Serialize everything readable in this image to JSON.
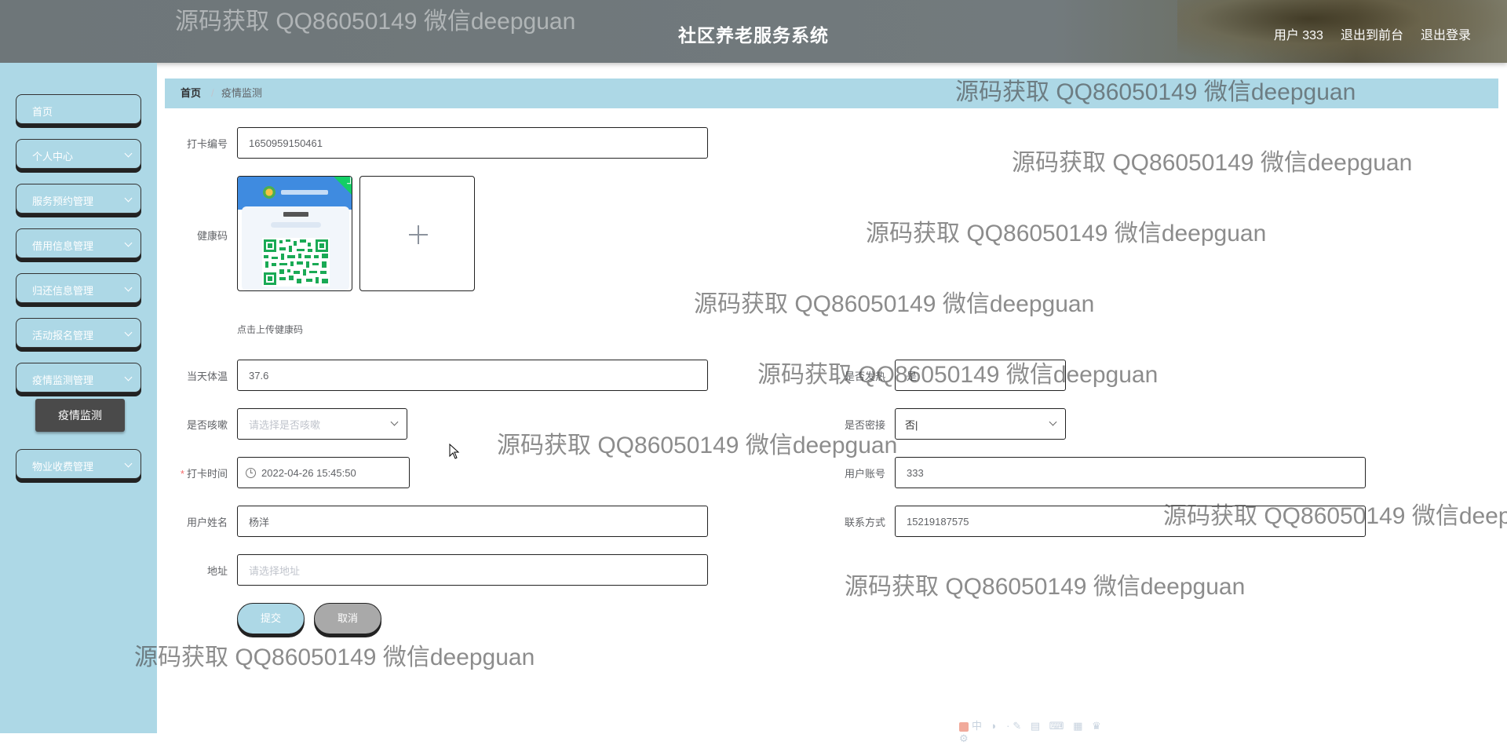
{
  "header": {
    "title": "社区养老服务系统",
    "user": "用户 333",
    "exit_front": "退出到前台",
    "logout": "退出登录"
  },
  "sidebar": {
    "items": [
      {
        "label": "首页",
        "has_submenu": false
      },
      {
        "label": "个人中心",
        "has_submenu": true
      },
      {
        "label": "服务预约管理",
        "has_submenu": true
      },
      {
        "label": "借用信息管理",
        "has_submenu": true
      },
      {
        "label": "归还信息管理",
        "has_submenu": true
      },
      {
        "label": "活动报名管理",
        "has_submenu": true
      },
      {
        "label": "疫情监测管理",
        "has_submenu": true
      },
      {
        "label": "物业收费管理",
        "has_submenu": true
      }
    ],
    "active_submenu": "疫情监测"
  },
  "breadcrumb": {
    "home": "首页",
    "separator": "/",
    "current": "疫情监测"
  },
  "form": {
    "checkin_no": {
      "label": "打卡编号",
      "value": "1650959150461"
    },
    "health_code": {
      "label": "健康码",
      "upload_tip": "点击上传健康码"
    },
    "temperature": {
      "label": "当天体温",
      "value": "37.6"
    },
    "fever": {
      "label": "是否发热",
      "value": "是"
    },
    "cough": {
      "label": "是否咳嗽",
      "placeholder": "请选择是否咳嗽"
    },
    "close_contact": {
      "label": "是否密接",
      "value": "否|"
    },
    "checkin_time": {
      "label": "打卡时间",
      "required_mark": "*",
      "value": "2022-04-26 15:45:50"
    },
    "account": {
      "label": "用户账号",
      "value": "333"
    },
    "name": {
      "label": "用户姓名",
      "value": "杨洋"
    },
    "phone": {
      "label": "联系方式",
      "value": "15219187575"
    },
    "address": {
      "label": "地址",
      "placeholder": "请选择地址"
    },
    "submit": "提交",
    "cancel": "取消"
  },
  "ime_toolbar": "中 ◗ ·✎ ▤ ⌨ ▦ ♛ ⚙",
  "watermark": "源码获取 QQ86050149 微信deepguan",
  "colors": {
    "sidebar_bg": "#add8e6",
    "header_bg": "#737b7e",
    "submenu_active": "#4a4a4a",
    "cancel_btn": "#a9a9a9"
  }
}
